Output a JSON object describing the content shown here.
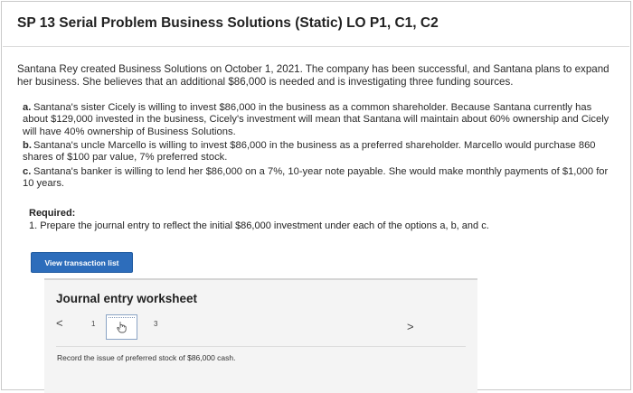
{
  "header": {
    "title": "SP 13 Serial Problem Business Solutions (Static) LO P1, C1, C2"
  },
  "problem": {
    "intro": "Santana Rey created Business Solutions on October 1, 2021. The company has been successful, and Santana plans to expand her business. She believes that an additional $86,000 is needed and is investigating three funding sources.",
    "options": [
      {
        "letter": "a.",
        "text": "Santana's sister Cicely is willing to invest $86,000 in the business as a common shareholder. Because Santana currently has about $129,000 invested in the business, Cicely's investment will mean that Santana will maintain about 60% ownership and Cicely will have 40% ownership of Business Solutions."
      },
      {
        "letter": "b.",
        "text": "Santana's uncle Marcello is willing to invest $86,000 in the business as a preferred shareholder. Marcello would purchase 860 shares of $100 par value, 7% preferred stock."
      },
      {
        "letter": "c.",
        "text": "Santana's banker is willing to lend her $86,000 on a 7%, 10-year note payable. She would make monthly payments of $1,000 for 10 years."
      }
    ]
  },
  "required": {
    "heading": "Required:",
    "text": "1. Prepare the journal entry to reflect the initial $86,000 investment under each of the options a, b, and c."
  },
  "toolbar": {
    "view_transaction_label": "View transaction list"
  },
  "worksheet": {
    "title": "Journal entry worksheet",
    "prev": "<",
    "next": ">",
    "pages": [
      "1",
      "2",
      "3"
    ],
    "current_page": 2,
    "instruction": "Record the issue of preferred stock of $86,000 cash."
  }
}
